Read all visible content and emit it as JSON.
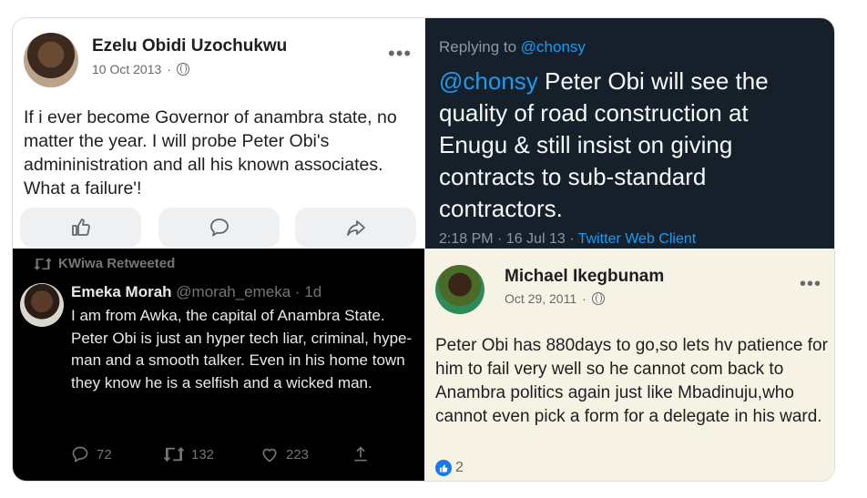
{
  "post1": {
    "author": "Ezelu Obidi Uzochukwu",
    "date": "10 Oct 2013",
    "more": "•••",
    "text": "If i ever become Governor of anambra state, no matter the year. I will probe Peter Obi's admininistration and all his known associates. What a failure'!",
    "avatar_icon": "avatar-photo"
  },
  "post2": {
    "replying_prefix": "Replying to",
    "replying_handle": "@chonsy",
    "mention": "@chonsy",
    "text": " Peter Obi will see the quality of road construction at Enugu & still insist on giving contracts to sub-standard contractors.",
    "timestamp": "2:18 PM · 16 Jul 13 ·",
    "client": "Twitter Web Client"
  },
  "post3": {
    "retweeted_by": "KWiwa Retweeted",
    "author": "Emeka Morah",
    "handle": "@morah_emeka · 1d",
    "text": "I am from Awka, the capital of Anambra State. Peter Obi is just an hyper tech liar, criminal, hype-man  and a smooth talker. Even in his home town they know he is a selfish and a wicked man.",
    "replies": "72",
    "retweets": "132",
    "likes": "223"
  },
  "post4": {
    "author": "Michael Ikegbunam",
    "date": "Oct 29, 2011",
    "more": "•••",
    "text": "Peter Obi has 880days to go,so lets hv patience for him to fail very well so he cannot com back to Anambra politics again just like Mbadinuju,who cannot even pick a form for a delegate in his ward.",
    "like_count": "2"
  },
  "colors": {
    "twitter_blue": "#1d9bf0",
    "facebook_blue": "#1877f2",
    "dark_bg": "#15202b",
    "black_bg": "#000000",
    "beige_bg": "#f6f3e4"
  }
}
